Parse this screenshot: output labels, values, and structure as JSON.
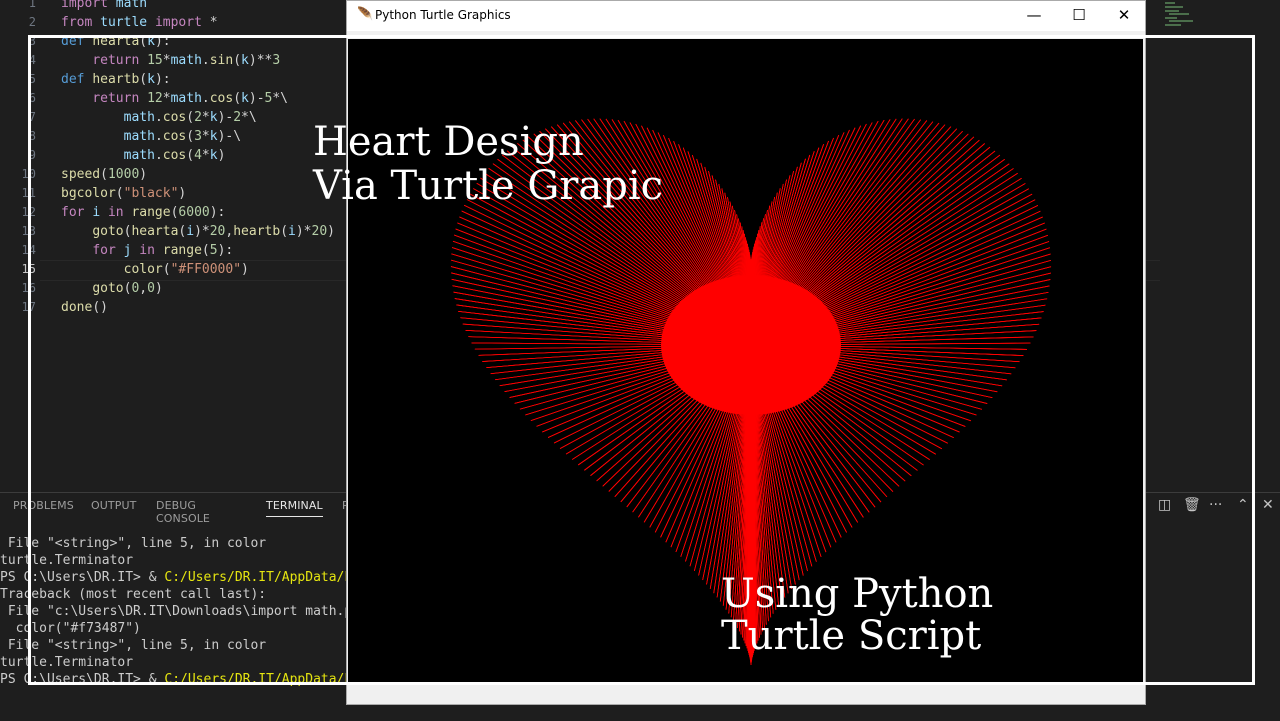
{
  "editor": {
    "lines": [
      {
        "n": "1",
        "html": "<span class='kw'>import</span> <span class='var'>math</span>"
      },
      {
        "n": "2",
        "html": "<span class='kw'>from</span> <span class='var'>turtle</span> <span class='kw'>import</span> *"
      },
      {
        "n": "3",
        "html": "<span class='bi'>def</span> <span class='fn'>hearta</span>(<span class='var'>k</span>):"
      },
      {
        "n": "4",
        "html": "    <span class='kw'>return</span> <span class='num'>15</span>*<span class='var'>math</span>.<span class='fn'>sin</span>(<span class='var'>k</span>)**<span class='num'>3</span>"
      },
      {
        "n": "5",
        "html": "<span class='bi'>def</span> <span class='fn'>heartb</span>(<span class='var'>k</span>):"
      },
      {
        "n": "6",
        "html": "    <span class='kw'>return</span> <span class='num'>12</span>*<span class='var'>math</span>.<span class='fn'>cos</span>(<span class='var'>k</span>)-<span class='num'>5</span>*\\"
      },
      {
        "n": "7",
        "html": "        <span class='var'>math</span>.<span class='fn'>cos</span>(<span class='num'>2</span>*<span class='var'>k</span>)-<span class='num'>2</span>*\\"
      },
      {
        "n": "8",
        "html": "        <span class='var'>math</span>.<span class='fn'>cos</span>(<span class='num'>3</span>*<span class='var'>k</span>)-\\"
      },
      {
        "n": "9",
        "html": "        <span class='var'>math</span>.<span class='fn'>cos</span>(<span class='num'>4</span>*<span class='var'>k</span>)"
      },
      {
        "n": "10",
        "html": "<span class='fn'>speed</span>(<span class='num'>1000</span>)"
      },
      {
        "n": "11",
        "html": "<span class='fn'>bgcolor</span>(<span class='str'>\"black\"</span>)"
      },
      {
        "n": "12",
        "html": "<span class='kw'>for</span> <span class='var'>i</span> <span class='kw'>in</span> <span class='fn'>range</span>(<span class='num'>6000</span>):"
      },
      {
        "n": "13",
        "html": "    <span class='fn'>goto</span>(<span class='fn'>hearta</span>(<span class='var'>i</span>)*<span class='num'>20</span>,<span class='fn'>heartb</span>(<span class='var'>i</span>)*<span class='num'>20</span>)"
      },
      {
        "n": "14",
        "html": "    <span class='kw'>for</span> <span class='var'>j</span> <span class='kw'>in</span> <span class='fn'>range</span>(<span class='num'>5</span>):"
      },
      {
        "n": "15",
        "html": "        <span class='fn'>color</span>(<span class='str'>\"#FF0000\"</span>)"
      },
      {
        "n": "16",
        "html": "    <span class='fn'>goto</span>(<span class='num'>0</span>,<span class='num'>0</span>)"
      },
      {
        "n": "17",
        "html": "<span class='fn'>done</span>()"
      }
    ]
  },
  "panel": {
    "tabs": [
      {
        "label": "PROBLEMS"
      },
      {
        "label": "OUTPUT"
      },
      {
        "label": "DEBUG CONSOLE"
      },
      {
        "label": "TERMINAL",
        "active": true
      },
      {
        "label": "P"
      }
    ],
    "terminal_lines": [
      {
        "text": " File \"<string>\", line 5, in color"
      },
      {
        "text": "turtle.Terminator"
      },
      {
        "text": "PS C:\\Users\\DR.IT> & ",
        "y": "C:/Users/DR.IT/AppData/Loca"
      },
      {
        "text": "Traceback (most recent call last):"
      },
      {
        "text": " File \"c:\\Users\\DR.IT\\Downloads\\import math.py\""
      },
      {
        "text": "  color(\"#f73487\")"
      },
      {
        "text": " File \"<string>\", line 5, in color"
      },
      {
        "text": "turtle.Terminator"
      },
      {
        "text": "PS C:\\Users\\DR.IT> & ",
        "y": "C:/Users/DR.IT/AppData/Loca"
      }
    ]
  },
  "turtle_window": {
    "title": "Python Turtle Graphics",
    "minimize": "—",
    "maximize": "☐",
    "close": "✕",
    "heart_color": "#ff0000",
    "background": "#000000"
  },
  "overlay": {
    "title_line1": "Heart Design",
    "title_line2": "Via Turtle Grapic",
    "sub_line1": "Using Python",
    "sub_line2": "Turtle Script"
  }
}
